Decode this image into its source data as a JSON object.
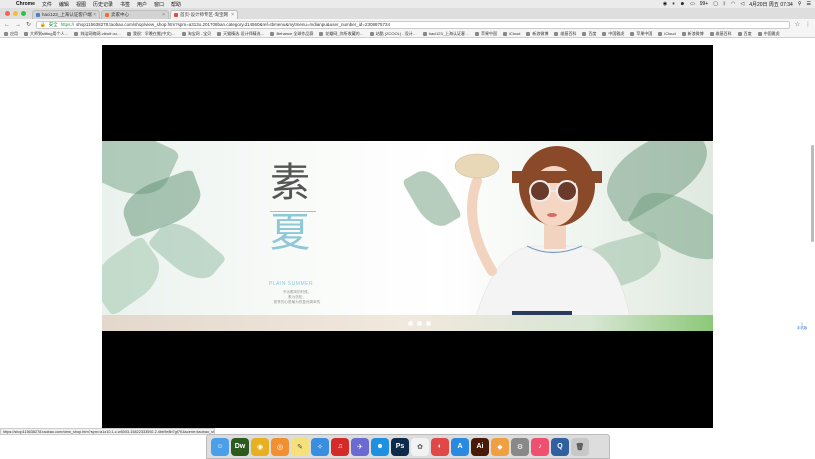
{
  "menubar": {
    "app": "Chrome",
    "items": [
      "文件",
      "编辑",
      "视图",
      "历史记录",
      "书签",
      "用户",
      "窗口",
      "帮助"
    ],
    "battery": "99+",
    "clock": "4月20日 周五 07:34"
  },
  "tabs": [
    {
      "title": "haci123_上海认证客户端",
      "active": false
    },
    {
      "title": "卖家中心",
      "active": false
    },
    {
      "title": "首页-设计师专区-淘宝网",
      "active": true
    }
  ],
  "toolbar": {
    "secure_label": "安全",
    "url_protocol": "https://",
    "url": "shop115638278.taobao.com/shop/view_shop.htm?spm=a313o.201708ban.category.d14560&ref=tbmenu&mytmenu=mdianpu&user_number_id=2308875734"
  },
  "bookmarks": [
    "应用",
    "大师到sitting用个人…",
    "纯洁网络网-vibolt·ou…",
    "我很：早晚在搬(中文)…",
    "淘宝网 - 宝贝",
    "天猫精选-设计师精选…",
    "Behance 全球作品赛",
    "花瓣网_你所收藏的…",
    "站酷 (ZCOOL) - 设计…",
    "haci123_上海认证客…",
    "苹果中国",
    "iCloud",
    "新浪微博",
    "维基百科",
    "百度",
    "中国雅虎",
    "苹果中国",
    "iCloud",
    "新浪微博",
    "维基百科",
    "百度",
    "中国雅虎"
  ],
  "banner": {
    "title_top": "素",
    "title_bottom": "夏",
    "subtitle": "PLAIN SUMMER",
    "slogan_lines": [
      "不远素简的时候，",
      "素为放松，",
      "夏季的心是最为恢复而简单的"
    ]
  },
  "status_url": "https://shop115638278.taobao.com/view_shop.htm?spm=a1z10.1-c.w5003-15822333592.2.4bb9e8b7gf7K&scene=taobao_shop",
  "side_widget": "手机版",
  "dock": [
    {
      "name": "finder",
      "color": "#4aa0e8",
      "glyph": "☺"
    },
    {
      "name": "dreamweaver",
      "color": "#2d5a1f",
      "glyph": "Dw"
    },
    {
      "name": "chrome",
      "color": "#e8b020",
      "glyph": "◉"
    },
    {
      "name": "sogou",
      "color": "#f09030",
      "glyph": "◎"
    },
    {
      "name": "notes",
      "color": "#f5e07a",
      "glyph": "✎"
    },
    {
      "name": "safari",
      "color": "#3a8ee0",
      "glyph": "✧"
    },
    {
      "name": "netease",
      "color": "#d42a2a",
      "glyph": "♫"
    },
    {
      "name": "rocket",
      "color": "#6a6ad0",
      "glyph": "✈"
    },
    {
      "name": "qq",
      "color": "#1e90e0",
      "glyph": "☻"
    },
    {
      "name": "photoshop",
      "color": "#0d2a4a",
      "glyph": "Ps"
    },
    {
      "name": "photos",
      "color": "#f2f2f2",
      "glyph": "✿"
    },
    {
      "name": "weibo",
      "color": "#e04848",
      "glyph": "◐"
    },
    {
      "name": "appstore",
      "color": "#2a8ae0",
      "glyph": "A"
    },
    {
      "name": "illustrator",
      "color": "#4a1a08",
      "glyph": "Ai"
    },
    {
      "name": "capsule",
      "color": "#f0a040",
      "glyph": "◆"
    },
    {
      "name": "preferences",
      "color": "#888888",
      "glyph": "⚙"
    },
    {
      "name": "itunes",
      "color": "#f05070",
      "glyph": "♪"
    },
    {
      "name": "quicktime",
      "color": "#3060a0",
      "glyph": "Q"
    },
    {
      "name": "trash",
      "color": "#c8c8c8",
      "glyph": "🗑"
    }
  ]
}
